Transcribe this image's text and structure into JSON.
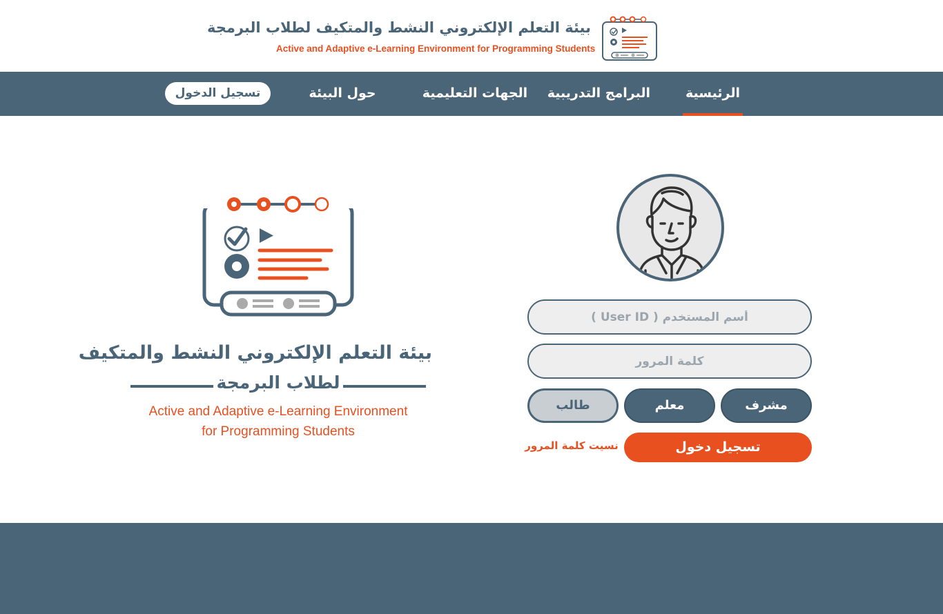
{
  "header": {
    "title_ar": "بيئة التعلم الإلكتروني النشط والمتكيف لطلاب البرمجة",
    "title_en": "Active and Adaptive e-Learning Environment for Programming Students",
    "logo_icon": "elearning-logo-icon"
  },
  "nav": {
    "home": "الرئيسية",
    "programs": "البرامج التدريبية",
    "institutions": "الجهات التعليمية",
    "about": "حول البيئة",
    "login": "تسجيل الدخول",
    "active_item": "home"
  },
  "brand": {
    "title_ar": "بيئة التعلم الإلكتروني النشط والمتكيف",
    "subtitle_ar": "لطلاب البرمجة",
    "title_en_line1": "Active and Adaptive e-Learning Environment",
    "title_en_line2": "for Programming Students"
  },
  "login": {
    "avatar_icon": "user-avatar-icon",
    "username_placeholder": "أسم المستخدم ( User ID )",
    "password_placeholder": "كلمة المرور",
    "role_supervisor": "مشرف",
    "role_teacher": "معلم",
    "role_student": "طالب",
    "selected_role": "student",
    "submit": "تسجيل دخول",
    "forgot_password": "نسيت كلمة المرور"
  },
  "colors": {
    "primary": "#4a6578",
    "accent": "#e85020",
    "field_bg": "#eeeeee"
  }
}
